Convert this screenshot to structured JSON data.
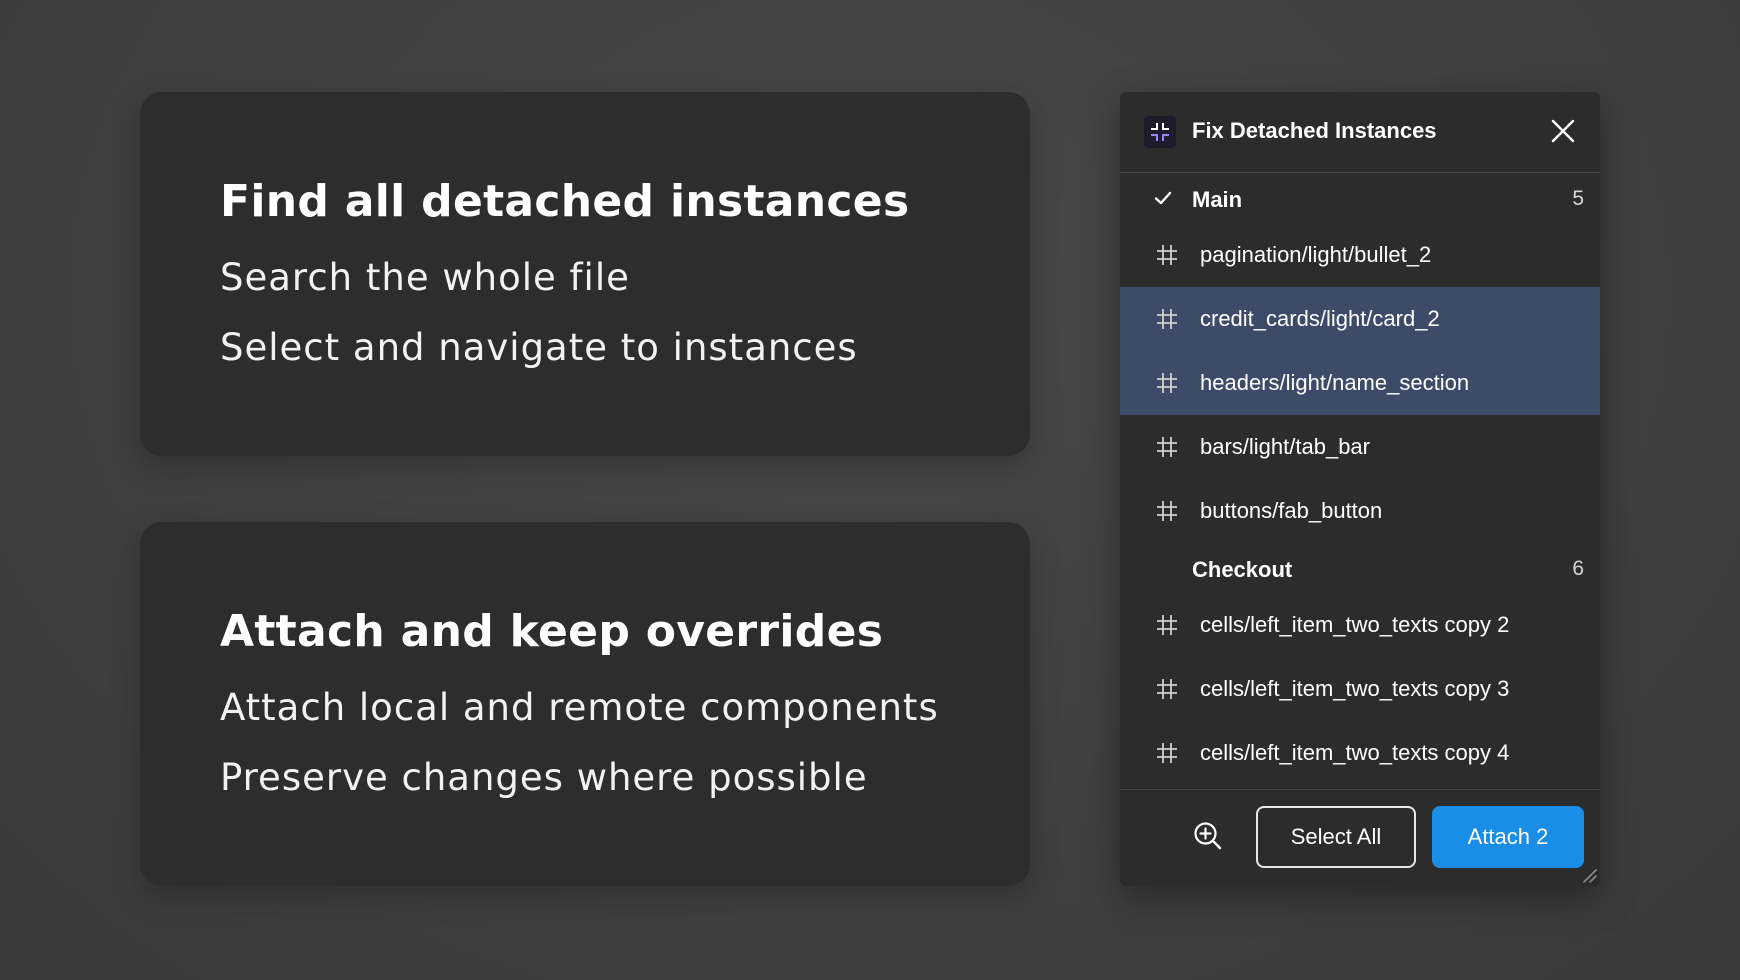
{
  "cards": [
    {
      "title": "Find all detached instances",
      "lines": [
        "Search the whole file",
        "Select and navigate to instances"
      ]
    },
    {
      "title": "Attach and keep overrides",
      "lines": [
        "Attach local and remote components",
        "Preserve changes where possible"
      ]
    }
  ],
  "panel": {
    "title": "Fix Detached Instances",
    "groups": [
      {
        "name": "Main",
        "count": "5",
        "checked": true,
        "items": [
          {
            "label": "pagination/light/bullet_2",
            "selected": false
          },
          {
            "label": "credit_cards/light/card_2",
            "selected": true
          },
          {
            "label": "headers/light/name_section",
            "selected": true
          },
          {
            "label": "bars/light/tab_bar",
            "selected": false
          },
          {
            "label": "buttons/fab_button",
            "selected": false
          }
        ]
      },
      {
        "name": "Checkout",
        "count": "6",
        "checked": false,
        "items": [
          {
            "label": "cells/left_item_two_texts copy 2",
            "selected": false
          },
          {
            "label": "cells/left_item_two_texts copy 3",
            "selected": false
          },
          {
            "label": "cells/left_item_two_texts copy 4",
            "selected": false
          }
        ]
      }
    ],
    "footer": {
      "zoom_icon": "zoom-in-icon",
      "select_all_label": "Select All",
      "attach_label": "Attach 2"
    }
  },
  "colors": {
    "selected_row": "#3d4a68",
    "attach_button": "#1a8ee6",
    "logo_accent": "#9a86ff"
  }
}
